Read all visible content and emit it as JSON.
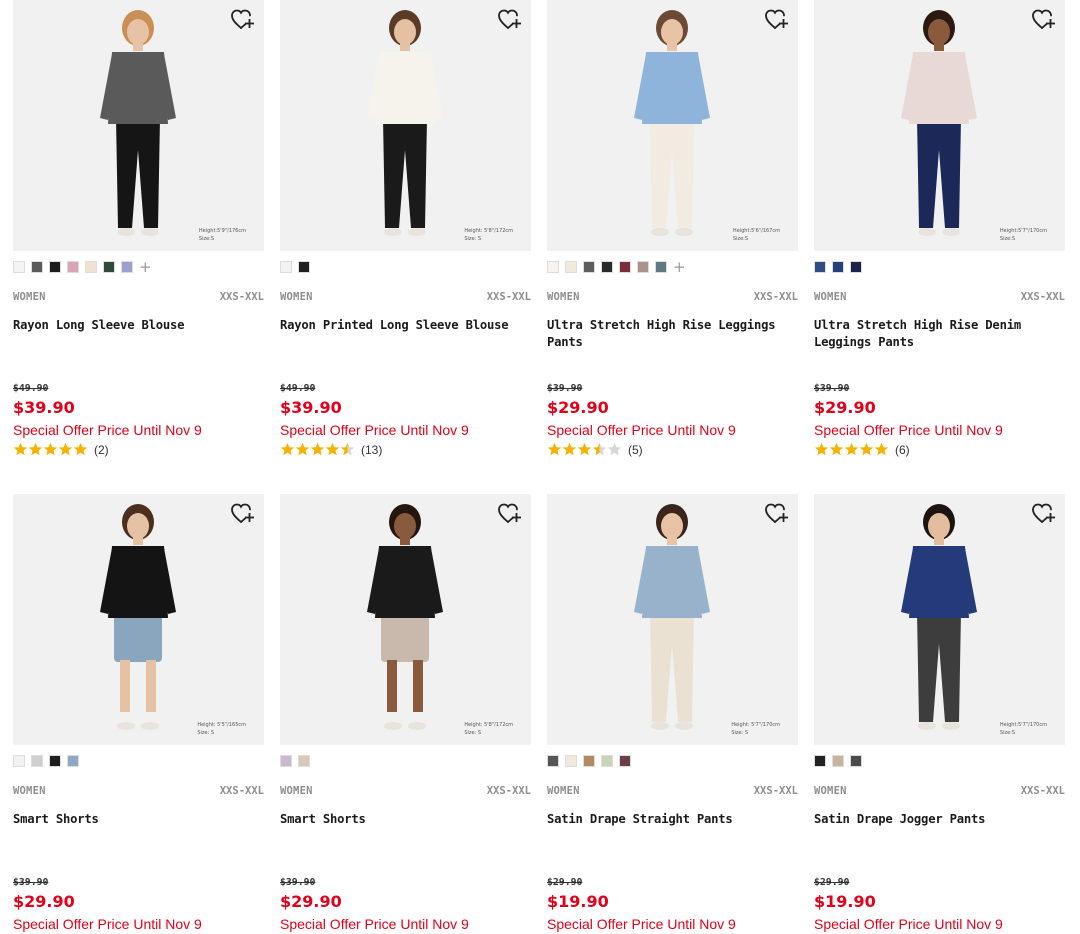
{
  "colors": {
    "price_red": "#e2001a",
    "star_gold": "#f5b301",
    "star_empty": "#d6d6d6",
    "grey_text": "#8e8e8e"
  },
  "wishlist_icon": "heart-plus-icon",
  "products": [
    {
      "gender": "WOMEN",
      "sizes": "XXS-XXL",
      "name": "Rayon Long Sleeve Blouse",
      "original_price": "$49.90",
      "price": "$39.90",
      "promo": "Special Offer Price Until Nov 9",
      "rating": 5,
      "reviews": "(2)",
      "model_info": [
        "Height:5'9\"/176cm",
        "Size:S"
      ],
      "swatches": [
        "#f4f4f4",
        "#5b5b5b",
        "#1c1c1c",
        "#d9a3b8",
        "#ede3d0",
        "#2f4a3a",
        "#9aa0d0"
      ],
      "more_colors": "+",
      "figure": {
        "top": "#5a5a5a",
        "bottom": "#151515",
        "skin": "#e8c2a6",
        "hair": "#c98f55"
      }
    },
    {
      "gender": "WOMEN",
      "sizes": "XXS-XXL",
      "name": "Rayon Printed Long Sleeve Blouse",
      "original_price": "$49.90",
      "price": "$39.90",
      "promo": "Special Offer Price Until Nov 9",
      "rating": 4.5,
      "reviews": "(13)",
      "model_info": [
        "Height: 5'8\"/172cm",
        "Size: S"
      ],
      "swatches": [
        "#f2f2f2",
        "#1f1f1f"
      ],
      "more_colors": "",
      "figure": {
        "top": "#f6f3ec",
        "bottom": "#1a1a1a",
        "skin": "#e6c0a3",
        "hair": "#5a3b26"
      }
    },
    {
      "gender": "WOMEN",
      "sizes": "XXS-XXL",
      "name": "Ultra Stretch High Rise Leggings Pants",
      "original_price": "$39.90",
      "price": "$29.90",
      "promo": "Special Offer Price Until Nov 9",
      "rating": 3.5,
      "reviews": "(5)",
      "model_info": [
        "Height:5'6\"/167cm",
        "Size:S"
      ],
      "swatches": [
        "#f7f3ee",
        "#f0ead8",
        "#5e5e5e",
        "#2a2a2a",
        "#7a2e3a",
        "#a8948a",
        "#5c7a7f"
      ],
      "more_colors": "+",
      "figure": {
        "top": "#8eb4dc",
        "bottom": "#f1ebe1",
        "skin": "#e8c3a6",
        "hair": "#6a4a35"
      }
    },
    {
      "gender": "WOMEN",
      "sizes": "XXS-XXL",
      "name": "Ultra Stretch High Rise Denim Leggings Pants",
      "original_price": "$39.90",
      "price": "$29.90",
      "promo": "Special Offer Price Until Nov 9",
      "rating": 5,
      "reviews": "(6)",
      "model_info": [
        "Height:5'7\"/170cm",
        "Size:S"
      ],
      "swatches": [
        "#2f4c86",
        "#25407a",
        "#1b2447"
      ],
      "more_colors": "",
      "figure": {
        "top": "#e8d8d6",
        "bottom": "#1c2857",
        "skin": "#8a5a3c",
        "hair": "#2a1a12"
      }
    },
    {
      "gender": "WOMEN",
      "sizes": "XXS-XXL",
      "name": "Smart Shorts",
      "original_price": "$39.90",
      "price": "$29.90",
      "promo": "Special Offer Price Until Nov 9",
      "rating": null,
      "reviews": "",
      "model_info": [
        "Height: 5'5\"/165cm",
        "Size: S"
      ],
      "swatches": [
        "#f2f2f2",
        "#cfcfcf",
        "#1e1e1e",
        "#8fa9c2"
      ],
      "more_colors": "",
      "figure": {
        "top": "#141414",
        "bottom": "#8aa6be",
        "skin": "#e6c2a5",
        "hair": "#4a2e1e"
      }
    },
    {
      "gender": "WOMEN",
      "sizes": "XXS-XXL",
      "name": "Smart Shorts",
      "original_price": "$39.90",
      "price": "$29.90",
      "promo": "Special Offer Price Until Nov 9",
      "rating": null,
      "reviews": "",
      "model_info": [
        "Height: 5'8\"/172cm",
        "Size: S"
      ],
      "swatches": [
        "#c9b8d0",
        "#d9c8bd"
      ],
      "more_colors": "",
      "figure": {
        "top": "#1a1a1a",
        "bottom": "#c9b8ac",
        "skin": "#8a5a3e",
        "hair": "#24160f"
      }
    },
    {
      "gender": "WOMEN",
      "sizes": "XXS-XXL",
      "name": "Satin Drape Straight Pants",
      "original_price": "$29.90",
      "price": "$19.90",
      "promo": "Special Offer Price Until Nov 9",
      "rating": null,
      "reviews": "",
      "model_info": [
        "Height: 5'7\"/170cm",
        "Size: S"
      ],
      "swatches": [
        "#555555",
        "#efe9df",
        "#b08a62",
        "#c9d3b8",
        "#6a3f4a"
      ],
      "more_colors": "",
      "figure": {
        "top": "#98b2cc",
        "bottom": "#ebe1d3",
        "skin": "#e8c3a6",
        "hair": "#3a251a"
      }
    },
    {
      "gender": "WOMEN",
      "sizes": "XXS-XXL",
      "name": "Satin Drape Jogger Pants",
      "original_price": "$29.90",
      "price": "$19.90",
      "promo": "Special Offer Price Until Nov 9",
      "rating": null,
      "reviews": "",
      "model_info": [
        "Height:5'7\"/170cm",
        "Size:S"
      ],
      "swatches": [
        "#222222",
        "#c8b39e",
        "#4a4a4a"
      ],
      "more_colors": "",
      "figure": {
        "top": "#243a7a",
        "bottom": "#3d3d3d",
        "skin": "#e3bd9e",
        "hair": "#1b1411"
      }
    }
  ]
}
